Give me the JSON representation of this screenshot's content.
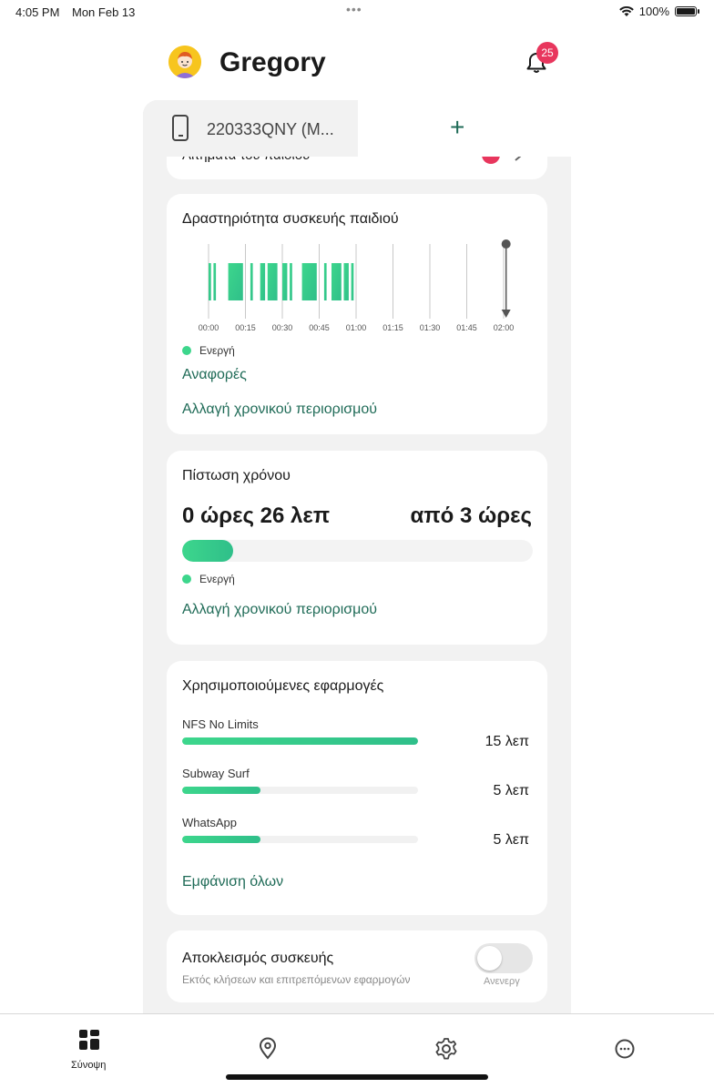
{
  "status_bar": {
    "time": "4:05 PM",
    "date": "Mon Feb 13",
    "dots": "•••",
    "battery": "100%"
  },
  "header": {
    "username": "Gregory",
    "notification_count": "25"
  },
  "device_tabs": {
    "active_device": "220333QNY (M...",
    "add_label": "+"
  },
  "partial_card": {
    "text": "Αιτήματα του παιδιού"
  },
  "activity": {
    "title": "Δραστηριότητα συσκευής παιδιού",
    "legend_active": "Ενεργή",
    "reports_link": "Αναφορές",
    "change_limit_link": "Αλλαγή χρονικού περιορισμού"
  },
  "chart_data": {
    "type": "bar",
    "title": "Δραστηριότητα συσκευής παιδιού",
    "x_ticks": [
      "00:00",
      "00:15",
      "00:30",
      "00:45",
      "01:00",
      "01:15",
      "01:30",
      "01:45",
      "02:00"
    ],
    "x_unit": "minutes",
    "active_intervals": [
      [
        0,
        1
      ],
      [
        2,
        3
      ],
      [
        8,
        14
      ],
      [
        17,
        18
      ],
      [
        21,
        23
      ],
      [
        24,
        28
      ],
      [
        30,
        32
      ],
      [
        33,
        34
      ],
      [
        38,
        44
      ],
      [
        47,
        48
      ],
      [
        50,
        54
      ],
      [
        55,
        57
      ],
      [
        58,
        59
      ]
    ],
    "current_time": 121,
    "series": [
      {
        "name": "Ενεργή",
        "color": "#3dd68c"
      }
    ]
  },
  "time_credit": {
    "title": "Πίστωση χρόνου",
    "used": "0 ώρες 26 λεπ",
    "total": "από 3 ώρες",
    "used_fraction": 0.145,
    "legend_active": "Ενεργή",
    "change_limit_link": "Αλλαγή χρονικού περιορισμού"
  },
  "apps": {
    "title": "Χρησιμοποιούμενες εφαρμογές",
    "items": [
      {
        "name": "NFS No Limits",
        "time": "15 λεπ",
        "fraction": 1.0
      },
      {
        "name": "Subway Surf",
        "time": "5 λεπ",
        "fraction": 0.333
      },
      {
        "name": "WhatsApp",
        "time": "5 λεπ",
        "fraction": 0.333
      }
    ],
    "show_all_link": "Εμφάνιση όλων"
  },
  "device_lock": {
    "title": "Αποκλεισμός συσκευής",
    "subtitle": "Εκτός κλήσεων και επιτρεπόμενων εφαρμογών",
    "toggle_label": "Ανενεργ"
  },
  "tab_bar": {
    "overview_label": "Σύνοψη",
    "icons": [
      "grid-icon",
      "location-pin-icon",
      "gear-icon",
      "more-icon"
    ]
  },
  "colors": {
    "accent": "#1f6b57",
    "active_green": "#3dd68c",
    "badge": "#e8365d"
  }
}
